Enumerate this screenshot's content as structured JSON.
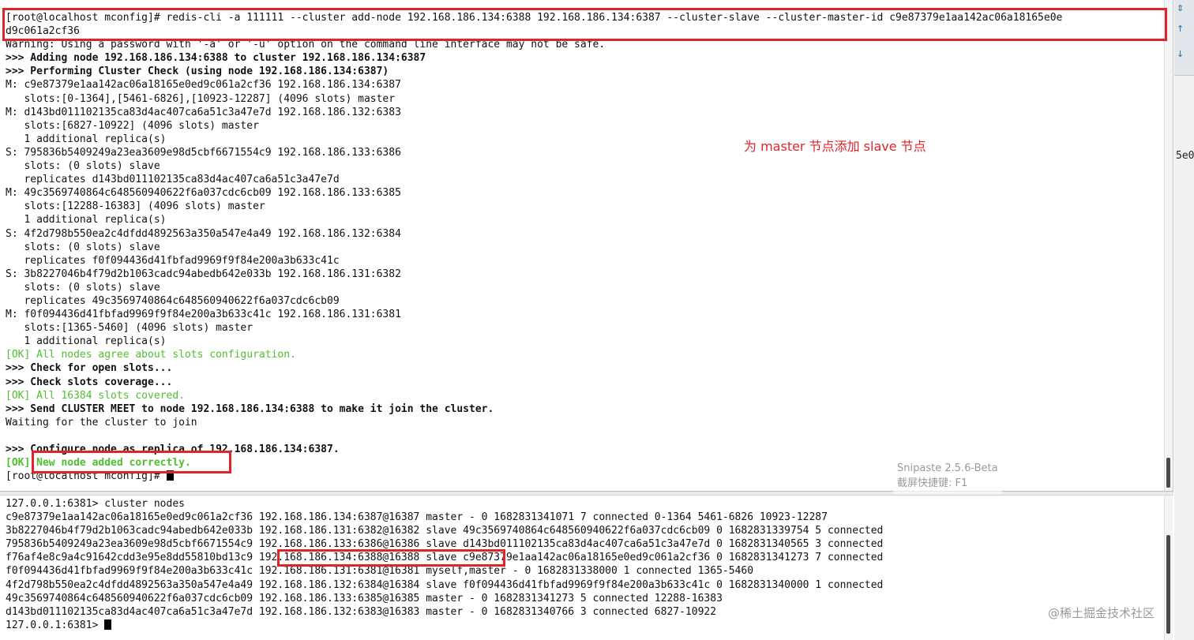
{
  "top_terminal": {
    "lines": [
      {
        "t": "[root@localhost mconfig]# redis-cli -a 111111 --cluster add-node 192.168.186.134:6388 192.168.186.134:6387 --cluster-slave --cluster-master-id c9e87379e1aa142ac06a18165e0e",
        "c": ""
      },
      {
        "t": "d9c061a2cf36",
        "c": ""
      },
      {
        "t": "Warning: Using a password with '-a' or '-u' option on the command line interface may not be safe.",
        "c": ""
      },
      {
        "t": ">>> Adding node 192.168.186.134:6388 to cluster 192.168.186.134:6387",
        "c": "b"
      },
      {
        "t": ">>> Performing Cluster Check (using node 192.168.186.134:6387)",
        "c": "b"
      },
      {
        "t": "M: c9e87379e1aa142ac06a18165e0ed9c061a2cf36 192.168.186.134:6387",
        "c": ""
      },
      {
        "t": "   slots:[0-1364],[5461-6826],[10923-12287] (4096 slots) master",
        "c": ""
      },
      {
        "t": "M: d143bd011102135ca83d4ac407ca6a51c3a47e7d 192.168.186.132:6383",
        "c": ""
      },
      {
        "t": "   slots:[6827-10922] (4096 slots) master",
        "c": ""
      },
      {
        "t": "   1 additional replica(s)",
        "c": ""
      },
      {
        "t": "S: 795836b5409249a23ea3609e98d5cbf6671554c9 192.168.186.133:6386",
        "c": ""
      },
      {
        "t": "   slots: (0 slots) slave",
        "c": ""
      },
      {
        "t": "   replicates d143bd011102135ca83d4ac407ca6a51c3a47e7d",
        "c": ""
      },
      {
        "t": "M: 49c3569740864c648560940622f6a037cdc6cb09 192.168.186.133:6385",
        "c": ""
      },
      {
        "t": "   slots:[12288-16383] (4096 slots) master",
        "c": ""
      },
      {
        "t": "   1 additional replica(s)",
        "c": ""
      },
      {
        "t": "S: 4f2d798b550ea2c4dfdd4892563a350a547e4a49 192.168.186.132:6384",
        "c": ""
      },
      {
        "t": "   slots: (0 slots) slave",
        "c": ""
      },
      {
        "t": "   replicates f0f094436d41fbfad9969f9f84e200a3b633c41c",
        "c": ""
      },
      {
        "t": "S: 3b8227046b4f79d2b1063cadc94abedb642e033b 192.168.186.131:6382",
        "c": ""
      },
      {
        "t": "   slots: (0 slots) slave",
        "c": ""
      },
      {
        "t": "   replicates 49c3569740864c648560940622f6a037cdc6cb09",
        "c": ""
      },
      {
        "t": "M: f0f094436d41fbfad9969f9f84e200a3b633c41c 192.168.186.131:6381",
        "c": ""
      },
      {
        "t": "   slots:[1365-5460] (4096 slots) master",
        "c": ""
      },
      {
        "t": "   1 additional replica(s)",
        "c": ""
      },
      {
        "t": "[OK] All nodes agree about slots configuration.",
        "c": "ok"
      },
      {
        "t": ">>> Check for open slots...",
        "c": "b"
      },
      {
        "t": ">>> Check slots coverage...",
        "c": "b"
      },
      {
        "t": "[OK] All 16384 slots covered.",
        "c": "ok"
      },
      {
        "t": ">>> Send CLUSTER MEET to node 192.168.186.134:6388 to make it join the cluster.",
        "c": "b"
      },
      {
        "t": "Waiting for the cluster to join",
        "c": ""
      },
      {
        "t": "",
        "c": ""
      },
      {
        "t": ">>> Configure node as replica of 192.168.186.134:6387.",
        "c": "b"
      },
      {
        "t": "[OK] New node added correctly.",
        "c": "okg"
      },
      {
        "t": "[root@localhost mconfig]# ",
        "c": "",
        "cursor": true
      }
    ]
  },
  "bottom_terminal": {
    "lines": [
      {
        "t": "127.0.0.1:6381> cluster nodes",
        "c": ""
      },
      {
        "t": "c9e87379e1aa142ac06a18165e0ed9c061a2cf36 192.168.186.134:6387@16387 master - 0 1682831341071 7 connected 0-1364 5461-6826 10923-12287",
        "c": ""
      },
      {
        "t": "3b8227046b4f79d2b1063cadc94abedb642e033b 192.168.186.131:6382@16382 slave 49c3569740864c648560940622f6a037cdc6cb09 0 1682831339754 5 connected",
        "c": ""
      },
      {
        "t": "795836b5409249a23ea3609e98d5cbf6671554c9 192.168.186.133:6386@16386 slave d143bd011102135ca83d4ac407ca6a51c3a47e7d 0 1682831340565 3 connected",
        "c": ""
      },
      {
        "t": "f76af4e8c9a4c91642cdd3e95e8dd55810bd13c9 192.168.186.134:6388@16388 slave c9e87379e1aa142ac06a18165e0ed9c061a2cf36 0 1682831341273 7 connected",
        "c": ""
      },
      {
        "t": "f0f094436d41fbfad9969f9f84e200a3b633c41c 192.168.186.131:6381@16381 myself,master - 0 1682831338000 1 connected 1365-5460",
        "c": ""
      },
      {
        "t": "4f2d798b550ea2c4dfdd4892563a350a547e4a49 192.168.186.132:6384@16384 slave f0f094436d41fbfad9969f9f84e200a3b633c41c 0 1682831340000 1 connected",
        "c": ""
      },
      {
        "t": "49c3569740864c648560940622f6a037cdc6cb09 192.168.186.133:6385@16385 master - 0 1682831341273 5 connected 12288-16383",
        "c": ""
      },
      {
        "t": "d143bd011102135ca83d4ac407ca6a51c3a47e7d 192.168.186.132:6383@16383 master - 0 1682831340766 3 connected 6827-10922",
        "c": ""
      },
      {
        "t": "127.0.0.1:6381> ",
        "c": "",
        "cursor": true
      }
    ]
  },
  "annotation_text": "为 master 节点添加 slave 节点",
  "snipaste": {
    "title": "Snipaste 2.5.6-Beta",
    "hint": "截屏快捷键: F1"
  },
  "watermark": "@稀土掘金技术社区",
  "side_peek": "5e0",
  "colors": {
    "highlight": "#e0242a",
    "ok_green": "#4fbf2f"
  }
}
